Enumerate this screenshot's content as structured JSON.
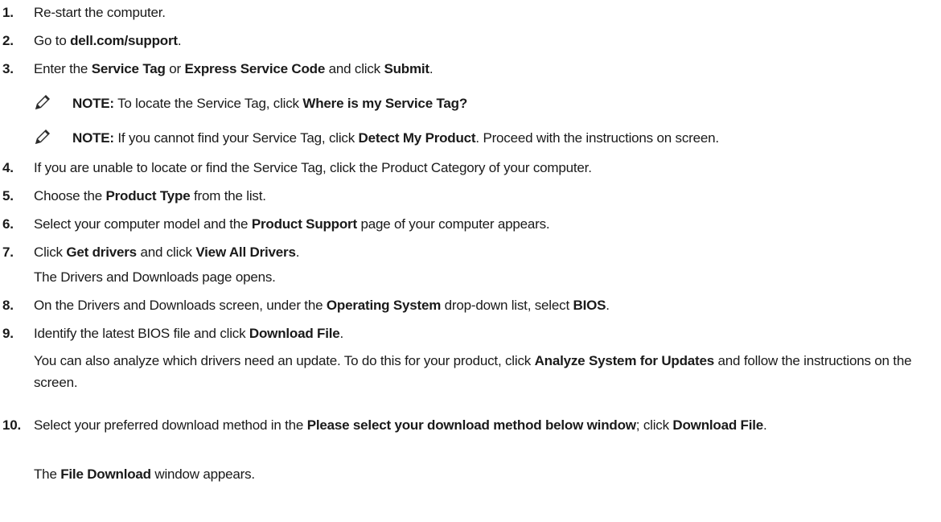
{
  "steps": [
    {
      "num": "1.",
      "parts": [
        {
          "t": "Re-start the computer."
        }
      ]
    },
    {
      "num": "2.",
      "parts": [
        {
          "t": "Go to "
        },
        {
          "t": "dell.com/support",
          "b": true
        },
        {
          "t": "."
        }
      ]
    },
    {
      "num": "3.",
      "parts": [
        {
          "t": "Enter the "
        },
        {
          "t": "Service Tag",
          "b": true
        },
        {
          "t": " or "
        },
        {
          "t": "Express Service Code",
          "b": true
        },
        {
          "t": " and click "
        },
        {
          "t": "Submit",
          "b": true
        },
        {
          "t": "."
        }
      ]
    },
    {
      "num": "4.",
      "parts": [
        {
          "t": "If you are unable to locate or find the Service Tag, click the Product Category of your computer."
        }
      ]
    },
    {
      "num": "5.",
      "parts": [
        {
          "t": "Choose the "
        },
        {
          "t": "Product Type",
          "b": true
        },
        {
          "t": " from the list."
        }
      ]
    },
    {
      "num": "6.",
      "parts": [
        {
          "t": "Select your computer model and the "
        },
        {
          "t": "Product Support",
          "b": true
        },
        {
          "t": " page of your computer appears."
        }
      ]
    },
    {
      "num": "7.",
      "parts": [
        {
          "t": "Click "
        },
        {
          "t": "Get drivers",
          "b": true
        },
        {
          "t": " and click "
        },
        {
          "t": "View All Drivers",
          "b": true
        },
        {
          "t": "."
        }
      ]
    },
    {
      "num": "8.",
      "parts": [
        {
          "t": "On the Drivers and Downloads screen, under the "
        },
        {
          "t": "Operating System",
          "b": true
        },
        {
          "t": " drop-down list, select "
        },
        {
          "t": "BIOS",
          "b": true
        },
        {
          "t": "."
        }
      ]
    },
    {
      "num": "9.",
      "parts": [
        {
          "t": "Identify the latest BIOS file and click "
        },
        {
          "t": "Download File",
          "b": true
        },
        {
          "t": "."
        }
      ]
    },
    {
      "num": "10.",
      "parts": [
        {
          "t": "Select your preferred download method in the "
        },
        {
          "t": "Please select your download method below window",
          "b": true
        },
        {
          "t": "; click "
        },
        {
          "t": "Download File",
          "b": true
        },
        {
          "t": "."
        }
      ]
    }
  ],
  "notes": [
    {
      "label": "NOTE:",
      "parts": [
        {
          "t": " To locate the Service Tag, click "
        },
        {
          "t": "Where is my Service Tag?",
          "b": true
        }
      ]
    },
    {
      "label": "NOTE:",
      "parts": [
        {
          "t": " If you cannot find your Service Tag, click "
        },
        {
          "t": "Detect My Product",
          "b": true
        },
        {
          "t": ". Proceed with the instructions on screen."
        }
      ]
    }
  ],
  "paras": {
    "p7": [
      {
        "t": "The Drivers and Downloads page opens."
      }
    ],
    "p9": [
      {
        "t": "You can also analyze which drivers need an update. To do this for your product, click "
      },
      {
        "t": "Analyze System for Updates",
        "b": true
      },
      {
        "t": " and follow the instructions on the screen."
      }
    ],
    "p10": [
      {
        "t": "The "
      },
      {
        "t": "File Download",
        "b": true
      },
      {
        "t": " window appears."
      }
    ]
  }
}
